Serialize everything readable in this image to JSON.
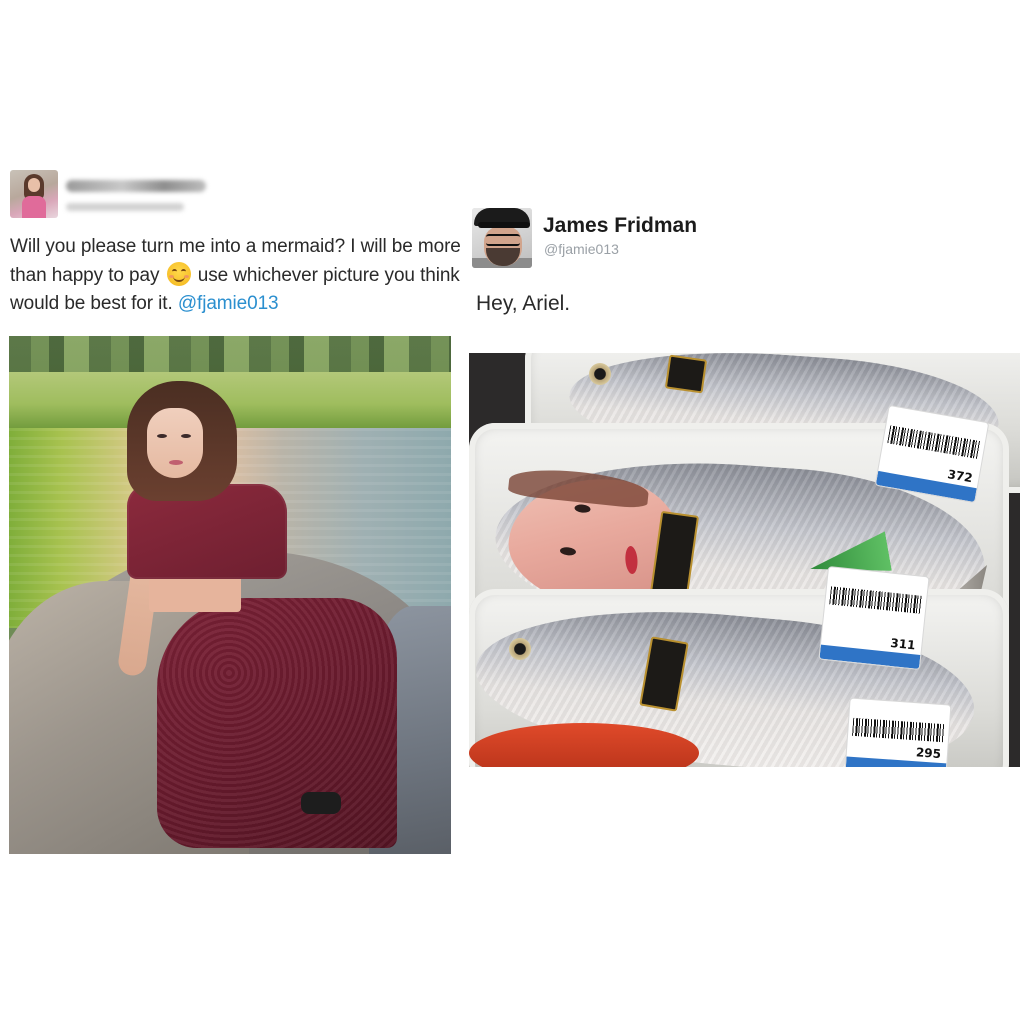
{
  "left_tweet": {
    "text_part1": "Will you please turn me into a mermaid? I will be more than happy to pay ",
    "text_part2": " use whichever picture you think would be best for it. ",
    "mention": "@fjamie013",
    "emoji_icon": "smiling-face-emoji"
  },
  "right_tweet": {
    "name": "James Fridman",
    "handle": "@fjamie013",
    "text": "Hey, Ariel."
  },
  "price_labels": {
    "label_1_price": "372",
    "label_2_price": "311",
    "label_3_price": "295"
  },
  "colors": {
    "mention": "#2b8fcf",
    "handle": "#9aa0a6",
    "label_strip": "#2f74c6"
  }
}
